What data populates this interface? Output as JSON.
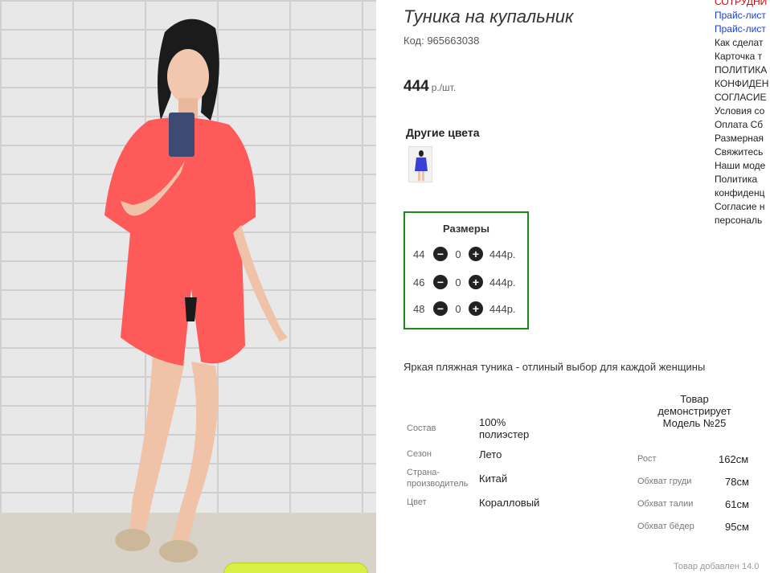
{
  "product": {
    "title": "Туника на купальник",
    "code_label": "Код: 965663038",
    "price": "444",
    "price_unit": "р./шт.",
    "other_colors_label": "Другие цвета",
    "description": "Яркая пляжная туника - отлиный выбор для каждой женщины",
    "added": "Товар добавлен 14.0"
  },
  "sizes": {
    "header": "Размеры",
    "rows": [
      {
        "size": "44",
        "qty": "0",
        "price": "444р."
      },
      {
        "size": "46",
        "qty": "0",
        "price": "444р."
      },
      {
        "size": "48",
        "qty": "0",
        "price": "444р."
      }
    ]
  },
  "attributes": [
    {
      "label": "Состав",
      "value": "100% полиэстер"
    },
    {
      "label": "Сезон",
      "value": "Лето"
    },
    {
      "label": "Страна-производитель",
      "value": "Китай"
    },
    {
      "label": "Цвет",
      "value": "Коралловый"
    }
  ],
  "model": {
    "header": "Товар демонстрирует Модель №25",
    "params": [
      {
        "label": "Рост",
        "value": "162см"
      },
      {
        "label": "Обхват груди",
        "value": "78см"
      },
      {
        "label": "Обхват талии",
        "value": "61см"
      },
      {
        "label": "Обхват бёдер",
        "value": "95см"
      }
    ]
  },
  "side_links": [
    {
      "text": "СОТРУДНИ",
      "color": "red"
    },
    {
      "text": "Прайс-лист",
      "color": "blue"
    },
    {
      "text": "Прайс-лист",
      "color": "blue"
    },
    {
      "text": "Как сделат",
      "color": "dark"
    },
    {
      "text": "Карточка т",
      "color": "dark"
    },
    {
      "text": "ПОЛИТИКА",
      "color": "dark"
    },
    {
      "text": "КОНФИДЕН",
      "color": "dark"
    },
    {
      "text": "СОГЛАСИЕ",
      "color": "dark"
    },
    {
      "text": "Условия со",
      "color": "dark"
    },
    {
      "text": "Оплата Сб",
      "color": "dark"
    },
    {
      "text": "Размерная",
      "color": "dark"
    },
    {
      "text": "Свяжитесь",
      "color": "dark"
    },
    {
      "text": "Наши моде",
      "color": "dark"
    },
    {
      "text": "Политика",
      "color": "dark"
    },
    {
      "text": "конфиденц",
      "color": "dark"
    },
    {
      "text": "Согласие н",
      "color": "dark"
    },
    {
      "text": "персональ",
      "color": "dark"
    }
  ],
  "colors": {
    "accent_border": "#1a8a1a",
    "tunic": "#ff5a5a",
    "link_blue": "#1a3fd6",
    "link_red": "#e00000",
    "cart_button": "#d8f044"
  }
}
